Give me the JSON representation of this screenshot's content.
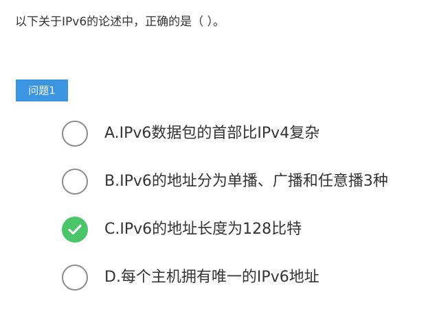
{
  "question": {
    "text": "以下关于IPv6的论述中，正确的是（ ）。"
  },
  "badge": {
    "label": "问题1",
    "color": "#3b95e0"
  },
  "options": [
    {
      "label": "A.IPv6数据包的首部比IPv4复杂",
      "selected": false
    },
    {
      "label": "B.IPv6的地址分为单播、广播和任意播3种",
      "selected": false
    },
    {
      "label": "C.IPv6的地址长度为128比特",
      "selected": true,
      "state_color": "#4cc56a",
      "icon": "checkmark-icon"
    },
    {
      "label": "D.每个主机拥有唯一的IPv6地址",
      "selected": false
    }
  ]
}
